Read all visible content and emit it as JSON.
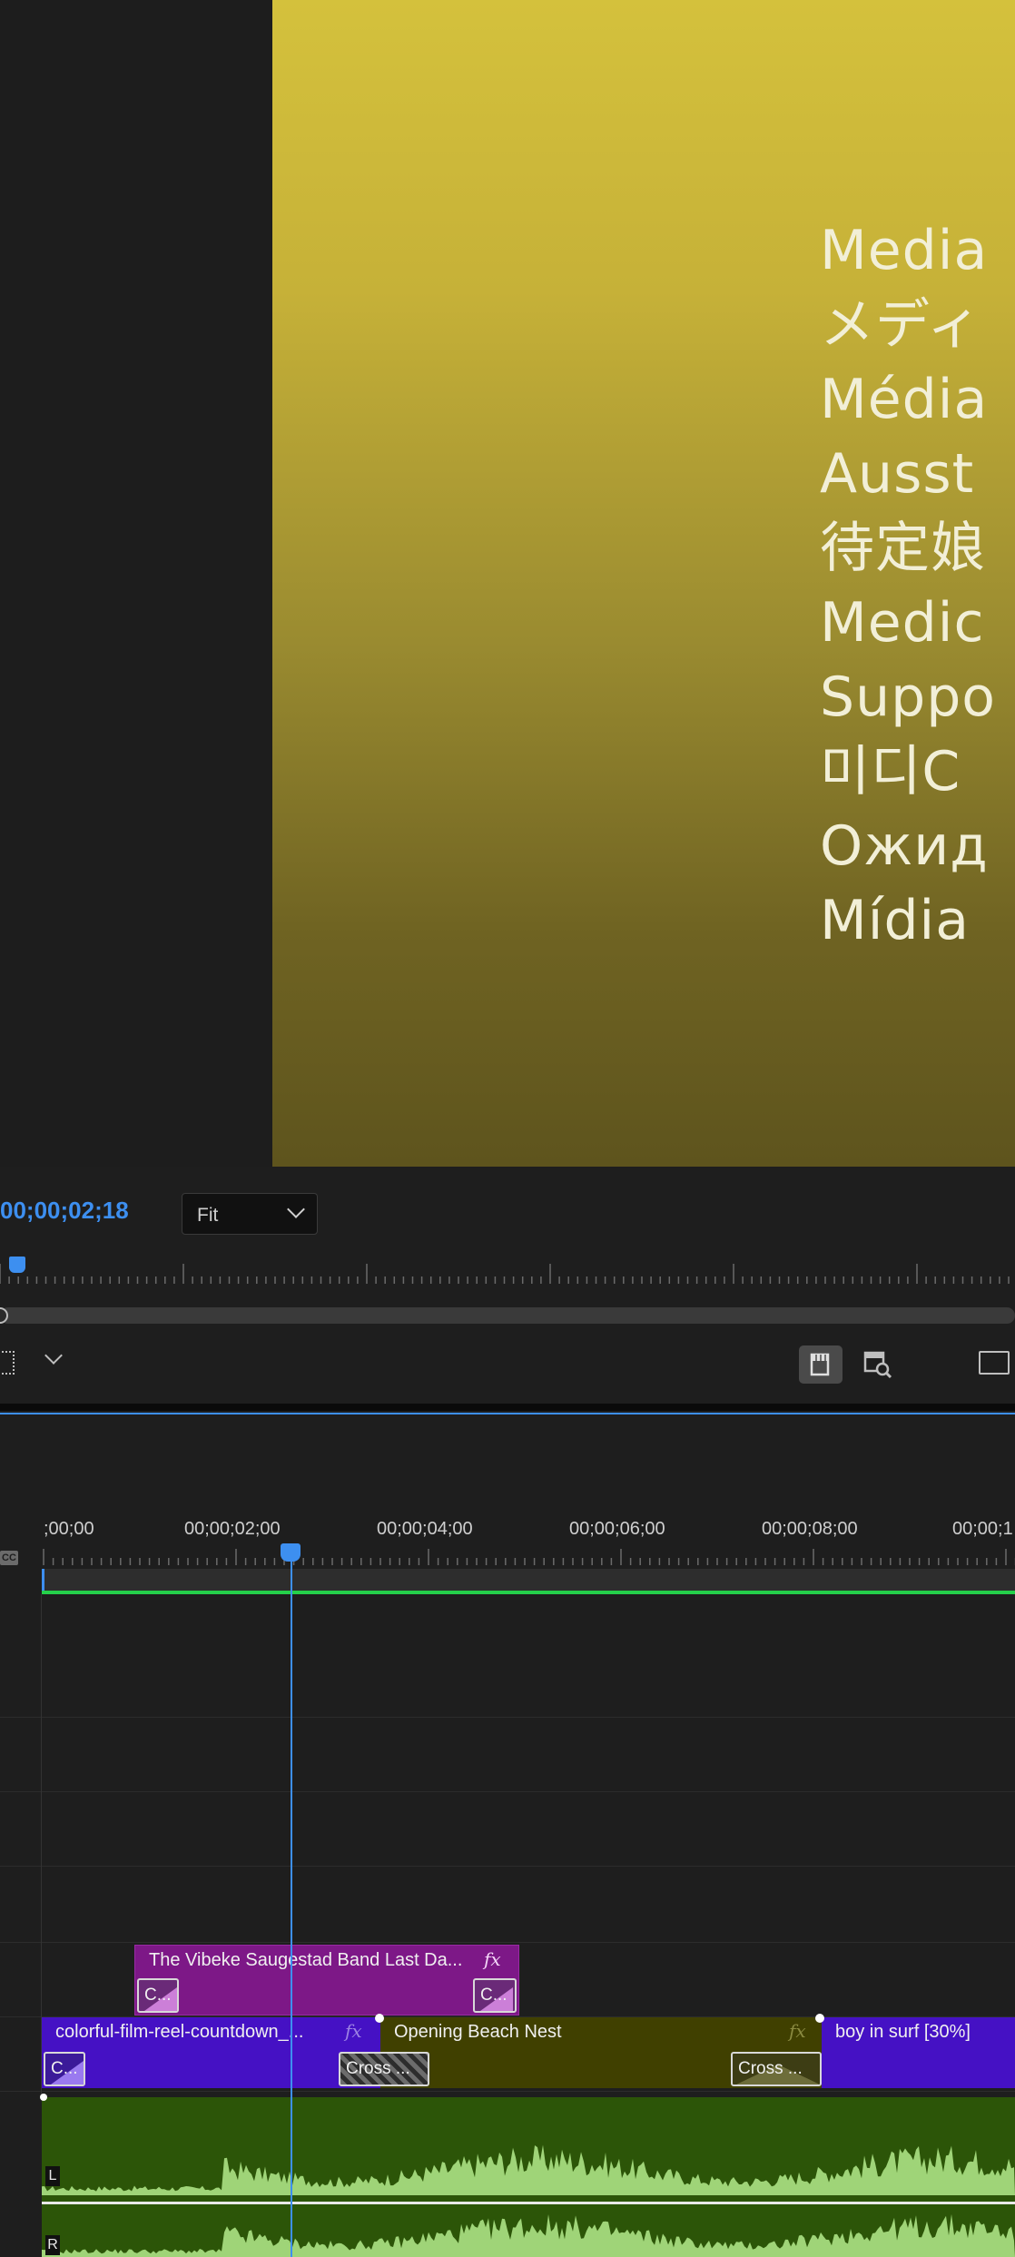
{
  "monitor": {
    "offline_lines": [
      "Media",
      "メディ",
      "Média",
      "Ausst",
      "待定娘",
      "Medic",
      "Suppo",
      "미디C",
      "Ожид",
      "Mídia"
    ],
    "timecode": "00;00;02;18",
    "fit_label": "Fit"
  },
  "timeline": {
    "ruler_labels": [
      ";00;00",
      "00;00;02;00",
      "00;00;04;00",
      "00;00;06;00",
      "00;00;08;00",
      "00;00;1"
    ],
    "cc_badge": "CC",
    "v2_clip": {
      "name": "The Vibeke Saugestad Band Last Da...",
      "fx": "fx",
      "trans_in": "C...",
      "trans_out": "C..."
    },
    "v1_clips": [
      {
        "name": "colorful-film-reel-countdown_...",
        "fx": "fx",
        "trans_in": "C..."
      },
      {
        "name": "Opening Beach Nest",
        "fx": "fx",
        "trans_in": "Cross ...",
        "trans_out": "Cross ..."
      },
      {
        "name": "boy in surf [30%]"
      }
    ],
    "audio_channels": [
      "L",
      "R"
    ]
  },
  "colors": {
    "accent": "#3d8ff0",
    "v2_clip": "#7d1887",
    "v1_clip_blue": "#4511c4",
    "v1_clip_olive": "#404000",
    "audio_clip": "#2c5508",
    "waveform": "#9fd478",
    "render_bar": "#25d04a"
  }
}
